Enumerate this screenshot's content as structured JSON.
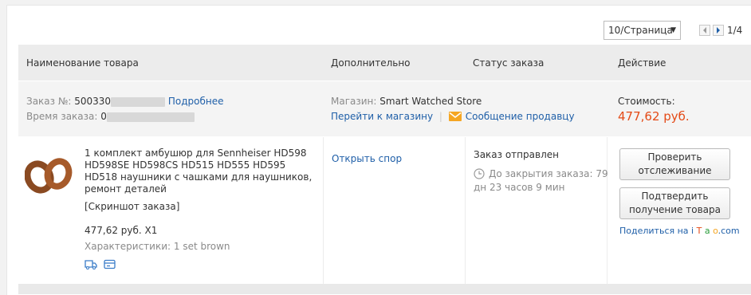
{
  "pagination": {
    "per_page": "10/Страница",
    "page": "1/4"
  },
  "table": {
    "headers": [
      "Наименование товара",
      "Дополнительно",
      "Статус заказа",
      "Действие"
    ]
  },
  "order": {
    "number_label": "Заказ №:",
    "number_value": "500330",
    "details_link": "Подробнее",
    "time_label": "Время заказа:",
    "time_value": "0",
    "store_label": "Магазин:",
    "store_name": "Smart Watched Store",
    "go_to_store": "Перейти к магазину",
    "separator": "|",
    "message_seller": "Сообщение продавцу",
    "cost_label": "Стоимость:",
    "cost_value": "477,62 руб."
  },
  "item": {
    "title": "1 комплект амбушюр для Sennheiser HD598 HD598SE HD598CS HD515 HD555 HD595 HD518 наушники с чашками для наушников, ремонт деталей",
    "screenshot_link": "[Скриншот заказа]",
    "price_qty": "477,62 руб. X1",
    "characteristics": "Характеристики: 1 set brown",
    "open_dispute": "Открыть спор",
    "status": "Заказ отправлен",
    "countdown": "До закрытия заказа: 79 дн 23 часов 9 мин",
    "check_tracking": "Проверить отслеживание",
    "confirm_receipt": "Подтвердить получение товара",
    "share_prefix": "Поделиться на",
    "share_brand": [
      "i",
      "T",
      "a",
      "o",
      ".com"
    ]
  },
  "colors": {
    "link": "#1f5fa8",
    "price": "#e44a16"
  }
}
